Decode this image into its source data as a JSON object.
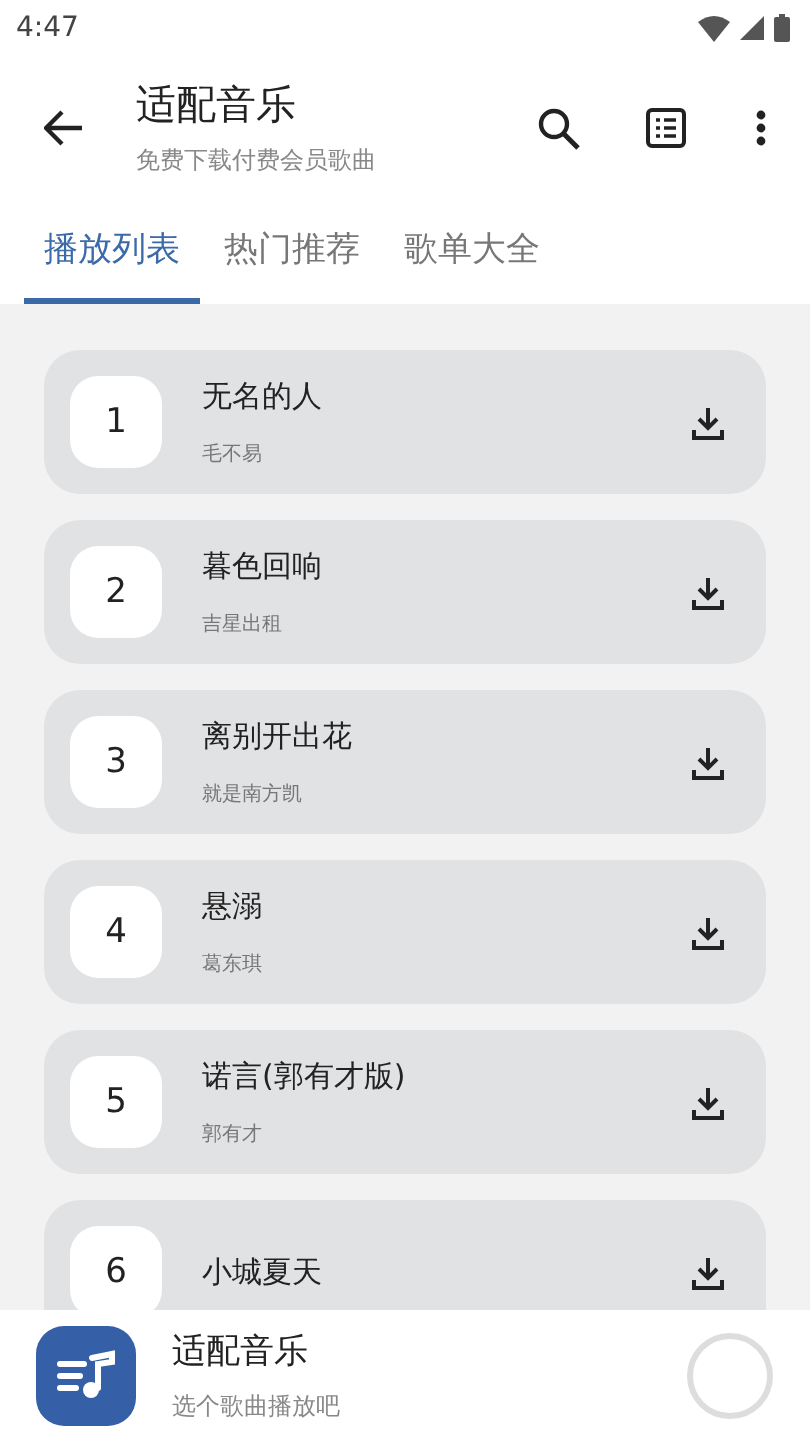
{
  "status_bar": {
    "time": "4:47"
  },
  "app_bar": {
    "title": "适配音乐",
    "subtitle": "免费下载付费会员歌曲"
  },
  "tabs": [
    {
      "label": "播放列表",
      "selected": true
    },
    {
      "label": "热门推荐",
      "selected": false
    },
    {
      "label": "歌单大全",
      "selected": false
    }
  ],
  "songs": [
    {
      "number": "1",
      "title": "无名的人",
      "artist": "毛不易"
    },
    {
      "number": "2",
      "title": "暮色回响",
      "artist": "吉星出租"
    },
    {
      "number": "3",
      "title": "离别开出花",
      "artist": "就是南方凯"
    },
    {
      "number": "4",
      "title": "悬溺",
      "artist": "葛东琪"
    },
    {
      "number": "5",
      "title": "诺言(郭有才版)",
      "artist": "郭有才"
    },
    {
      "number": "6",
      "title": "小城夏天"
    }
  ],
  "player": {
    "title": "适配音乐",
    "subtitle": "选个歌曲播放吧"
  }
}
